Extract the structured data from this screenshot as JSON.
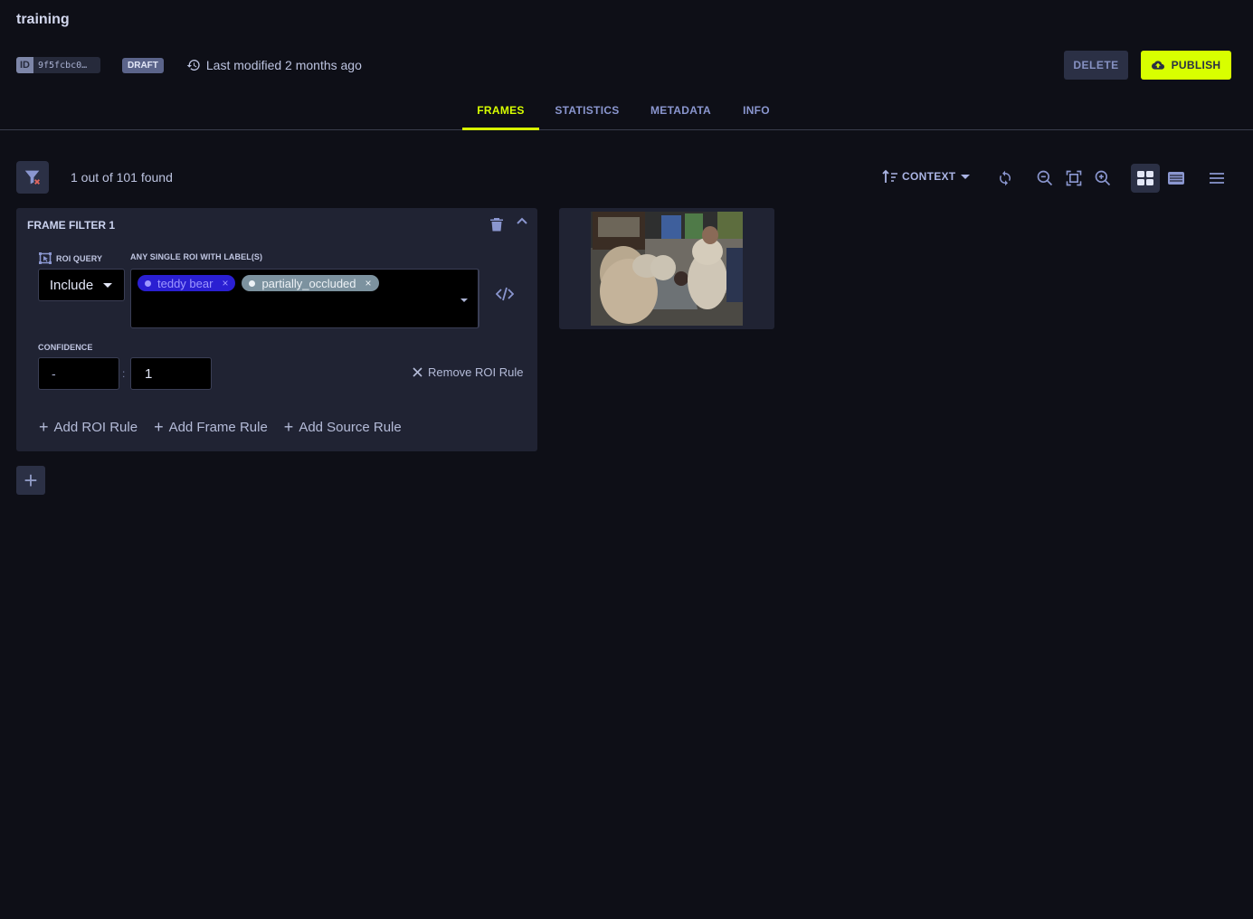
{
  "header": {
    "title": "training",
    "id_label": "ID",
    "id_value": "9f5fcbc0…",
    "status_badge": "DRAFT",
    "last_modified": "Last modified 2 months ago",
    "delete_label": "DELETE",
    "publish_label": "PUBLISH"
  },
  "tabs": [
    {
      "label": "FRAMES",
      "active": true
    },
    {
      "label": "STATISTICS",
      "active": false
    },
    {
      "label": "METADATA",
      "active": false
    },
    {
      "label": "INFO",
      "active": false
    }
  ],
  "results": {
    "found_text": "1 out of 101 found"
  },
  "toolbar": {
    "sort_label": "CONTEXT",
    "icons": [
      "sort-icon",
      "refresh-icon",
      "zoom-out-icon",
      "fit-screen-icon",
      "zoom-in-icon",
      "grid-view-icon",
      "list-view-icon",
      "menu-icon"
    ],
    "active_view": "grid"
  },
  "filter_panel": {
    "title": "FRAME FILTER 1",
    "roi_query_label": "ROI QUERY",
    "roi_query_value": "Include",
    "labels_label": "ANY SINGLE ROI WITH LABEL(S)",
    "chips": [
      {
        "label": "teddy bear",
        "color": "#2a1fd2"
      },
      {
        "label": "partially_occluded",
        "color": "#7c929f"
      }
    ],
    "confidence_label": "CONFIDENCE",
    "confidence_min": "-",
    "confidence_sep": ":",
    "confidence_max": "1",
    "remove_rule_label": "Remove ROI Rule",
    "add_rules": [
      "Add ROI Rule",
      "Add Frame Rule",
      "Add Source Rule"
    ]
  },
  "colors": {
    "accent": "#d8ff00",
    "background": "#0e0f17",
    "panel": "#202333"
  },
  "gallery": {
    "items": [
      {
        "description": "Giant teddy bears at a table in a warehouse store with a child and woman"
      }
    ]
  }
}
